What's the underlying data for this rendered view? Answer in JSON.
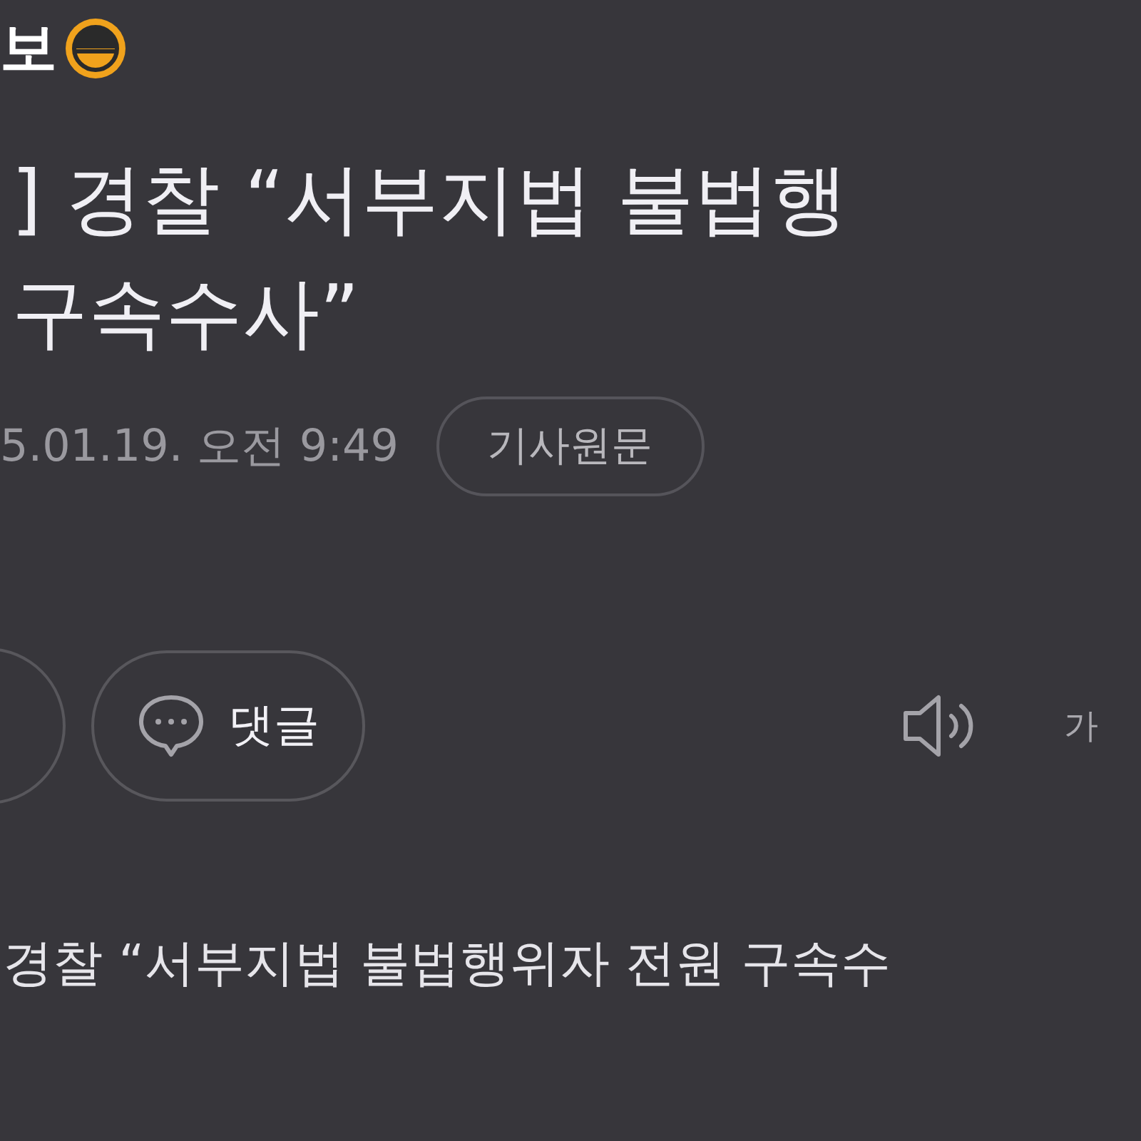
{
  "header": {
    "logo_text": "보"
  },
  "headline": {
    "lines": [
      "] 경찰 “서부지법 불법행",
      "구속수사”"
    ]
  },
  "meta": {
    "date": "5.01.19. 오전 9:49",
    "source_button": "기사원문"
  },
  "actions": {
    "comment_button": "댓글",
    "font_size_button": "가"
  },
  "body": {
    "text": "경찰 “서부지법 불법행위자 전원 구속수"
  }
}
